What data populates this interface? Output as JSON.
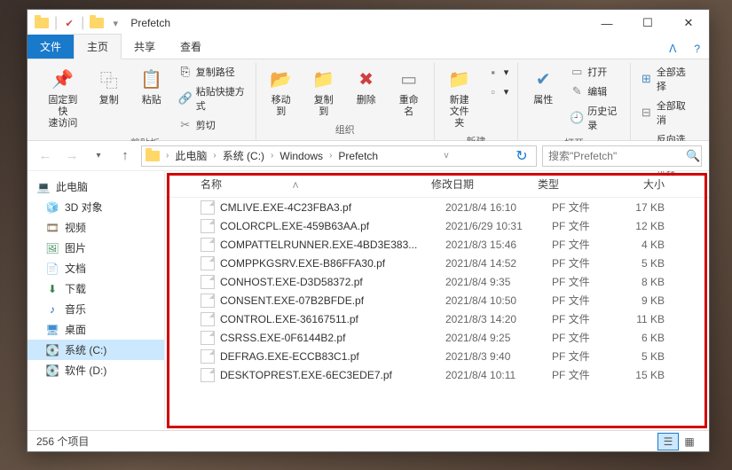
{
  "window": {
    "title": "Prefetch",
    "controls": {
      "minimize": "—",
      "maximize": "☐",
      "close": "✕"
    }
  },
  "tabs": {
    "file": "文件",
    "home": "主页",
    "share": "共享",
    "view": "查看"
  },
  "ribbon": {
    "groups": {
      "clipboard": {
        "label": "剪贴板",
        "pin": "固定到快\n速访问",
        "copy": "复制",
        "paste": "粘贴",
        "copy_path": "复制路径",
        "paste_shortcut": "粘贴快捷方式",
        "cut": "剪切"
      },
      "organize": {
        "label": "组织",
        "move_to": "移动到",
        "copy_to": "复制到",
        "delete": "删除",
        "rename": "重命名"
      },
      "new": {
        "label": "新建",
        "new_folder": "新建\n文件夹"
      },
      "open": {
        "label": "打开",
        "properties": "属性",
        "open": "打开",
        "edit": "编辑",
        "history": "历史记录"
      },
      "select": {
        "label": "选择",
        "select_all": "全部选择",
        "select_none": "全部取消",
        "invert": "反向选择"
      }
    }
  },
  "address": {
    "segments": [
      "此电脑",
      "系统 (C:)",
      "Windows",
      "Prefetch"
    ]
  },
  "search": {
    "placeholder": "搜索\"Prefetch\""
  },
  "navpane": {
    "root": "此电脑",
    "items": [
      {
        "icon": "🧊",
        "label": "3D 对象",
        "color": "#40b0e0"
      },
      {
        "icon": "🎞",
        "label": "视频",
        "color": "#7a5c3c"
      },
      {
        "icon": "🖼",
        "label": "图片",
        "color": "#489060"
      },
      {
        "icon": "📄",
        "label": "文档",
        "color": "#4a8cc0"
      },
      {
        "icon": "⬇",
        "label": "下载",
        "color": "#388048"
      },
      {
        "icon": "♪",
        "label": "音乐",
        "color": "#2060c0"
      },
      {
        "icon": "🖥",
        "label": "桌面",
        "color": "#4090d0"
      },
      {
        "icon": "💽",
        "label": "系统 (C:)",
        "color": "#888",
        "selected": true
      },
      {
        "icon": "💽",
        "label": "软件 (D:)",
        "color": "#888"
      }
    ]
  },
  "columns": {
    "name": "名称",
    "date": "修改日期",
    "type": "类型",
    "size": "大小"
  },
  "files": [
    {
      "name": "CMLIVE.EXE-4C23FBA3.pf",
      "date": "2021/8/4 16:10",
      "type": "PF 文件",
      "size": "17 KB"
    },
    {
      "name": "COLORCPL.EXE-459B63AA.pf",
      "date": "2021/6/29 10:31",
      "type": "PF 文件",
      "size": "12 KB"
    },
    {
      "name": "COMPATTELRUNNER.EXE-4BD3E383...",
      "date": "2021/8/3 15:46",
      "type": "PF 文件",
      "size": "4 KB"
    },
    {
      "name": "COMPPKGSRV.EXE-B86FFA30.pf",
      "date": "2021/8/4 14:52",
      "type": "PF 文件",
      "size": "5 KB"
    },
    {
      "name": "CONHOST.EXE-D3D58372.pf",
      "date": "2021/8/4 9:35",
      "type": "PF 文件",
      "size": "8 KB"
    },
    {
      "name": "CONSENT.EXE-07B2BFDE.pf",
      "date": "2021/8/4 10:50",
      "type": "PF 文件",
      "size": "9 KB"
    },
    {
      "name": "CONTROL.EXE-36167511.pf",
      "date": "2021/8/3 14:20",
      "type": "PF 文件",
      "size": "11 KB"
    },
    {
      "name": "CSRSS.EXE-0F6144B2.pf",
      "date": "2021/8/4 9:25",
      "type": "PF 文件",
      "size": "6 KB"
    },
    {
      "name": "DEFRAG.EXE-ECCB83C1.pf",
      "date": "2021/8/3 9:40",
      "type": "PF 文件",
      "size": "5 KB"
    },
    {
      "name": "DESKTOPREST.EXE-6EC3EDE7.pf",
      "date": "2021/8/4 10:11",
      "type": "PF 文件",
      "size": "15 KB"
    }
  ],
  "status": {
    "item_count": "256 个项目"
  }
}
